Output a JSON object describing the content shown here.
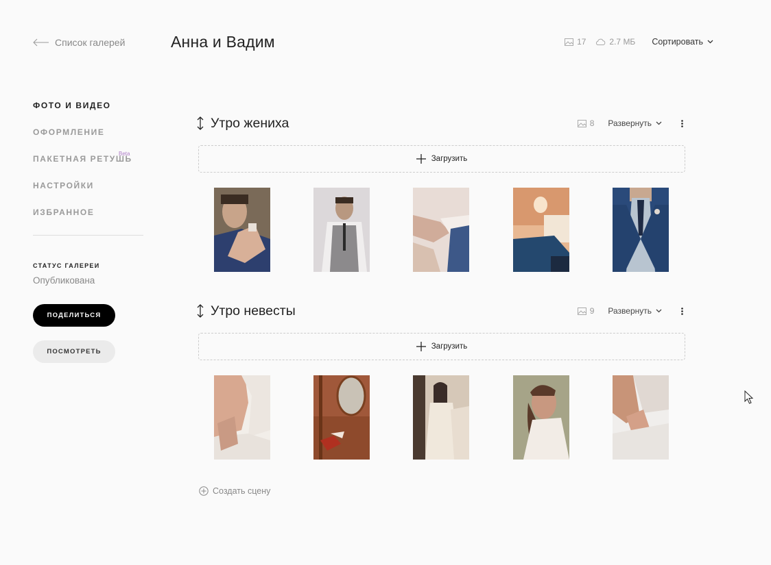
{
  "header": {
    "back_label": "Список галерей",
    "title": "Анна и Вадим",
    "photo_count": "17",
    "storage": "2.7 МБ",
    "sort_label": "Сортировать"
  },
  "sidebar": {
    "items": [
      {
        "label": "ФОТО И ВИДЕО",
        "active": true
      },
      {
        "label": "ОФОРМЛЕНИЕ"
      },
      {
        "label": "ПАКЕТНАЯ РЕТУШЬ",
        "badge": "Beta"
      },
      {
        "label": "НАСТРОЙКИ"
      },
      {
        "label": "ИЗБРАННОЕ"
      }
    ],
    "status_label": "СТАТУС ГАЛЕРЕИ",
    "status_value": "Опубликована",
    "share_label": "ПОДЕЛИТЬСЯ",
    "view_label": "ПОСМОТРЕТЬ"
  },
  "scenes": [
    {
      "title": "Утро жениха",
      "count": "8",
      "expand_label": "Развернуть",
      "upload_label": "Загрузить",
      "photos": [
        {
          "desc": "groom-boutonniere",
          "colors": [
            "#6a5a48",
            "#2d3f6e",
            "#caa890"
          ]
        },
        {
          "desc": "groom-grey-vest",
          "colors": [
            "#d8d4d6",
            "#8a8888",
            "#3a3a3a"
          ]
        },
        {
          "desc": "cufflinks-hands",
          "colors": [
            "#e6dcd6",
            "#c2a292",
            "#3d5888"
          ]
        },
        {
          "desc": "room-blue-jacket",
          "colors": [
            "#e0b08a",
            "#24486e",
            "#f2e2cc"
          ]
        },
        {
          "desc": "groom-blue-suit",
          "colors": [
            "#2a4a7a",
            "#b8c4d0",
            "#1e2a44"
          ]
        }
      ]
    },
    {
      "title": "Утро невесты",
      "count": "9",
      "expand_label": "Развернуть",
      "upload_label": "Загрузить",
      "photos": [
        {
          "desc": "lace-dress-back",
          "colors": [
            "#d8a890",
            "#f2eee9",
            "#c99a84"
          ]
        },
        {
          "desc": "mirror-shoes",
          "colors": [
            "#8e4a2c",
            "#c9c2b6",
            "#b03020"
          ]
        },
        {
          "desc": "bride-mirror",
          "colors": [
            "#d6c8b8",
            "#3a2c28",
            "#f0e8dc"
          ]
        },
        {
          "desc": "bride-portrait",
          "colors": [
            "#a6a488",
            "#5a3a2a",
            "#f2ece6"
          ]
        },
        {
          "desc": "dress-buttons",
          "colors": [
            "#c89478",
            "#f0eeec",
            "#e0d8d2"
          ]
        }
      ]
    }
  ],
  "create_scene_label": "Создать сцену"
}
